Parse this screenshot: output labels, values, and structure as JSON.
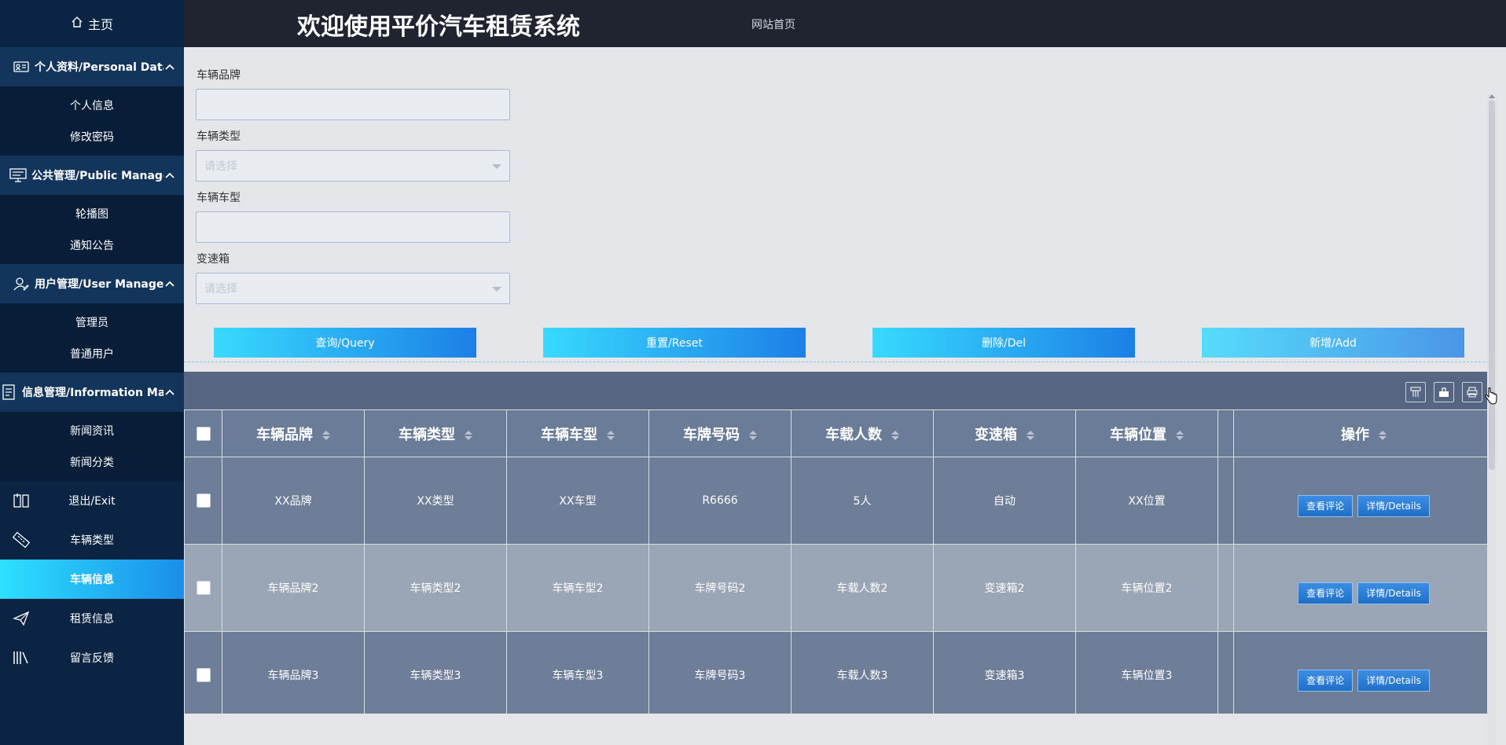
{
  "sidebar": {
    "home_label": "主页",
    "groups": [
      {
        "label": "个人资料/Personal Data",
        "items": [
          "个人信息",
          "修改密码"
        ]
      },
      {
        "label": "公共管理/Public Manage",
        "items": [
          "轮播图",
          "通知公告"
        ]
      },
      {
        "label": "用户管理/User Manage",
        "items": [
          "管理员",
          "普通用户"
        ]
      },
      {
        "label": "信息管理/Information Manage",
        "items": [
          "新闻资讯",
          "新闻分类"
        ]
      }
    ],
    "top_items": [
      "退出/Exit",
      "车辆类型",
      "车辆信息",
      "租赁信息",
      "留言反馈"
    ],
    "active_item": "车辆信息"
  },
  "header": {
    "title": "欢迎使用平价汽车租赁系统",
    "home_link": "网站首页"
  },
  "form": {
    "brand_label": "车辆品牌",
    "brand_value": "",
    "type_label": "车辆类型",
    "type_placeholder": "请选择",
    "model_label": "车辆车型",
    "model_value": "",
    "gearbox_label": "变速箱",
    "gearbox_placeholder": "请选择"
  },
  "actions": {
    "query": "查询/Query",
    "reset": "重置/Reset",
    "delete": "删除/Del",
    "add": "新增/Add"
  },
  "table": {
    "columns": [
      "车辆品牌",
      "车辆类型",
      "车辆车型",
      "车牌号码",
      "车载人数",
      "变速箱",
      "车辆位置",
      "操作"
    ],
    "rows": [
      [
        "XX品牌",
        "XX类型",
        "XX车型",
        "R6666",
        "5人",
        "自动",
        "XX位置"
      ],
      [
        "车辆品牌2",
        "车辆类型2",
        "车辆车型2",
        "车牌号码2",
        "车载人数2",
        "变速箱2",
        "车辆位置2"
      ],
      [
        "车辆品牌3",
        "车辆类型3",
        "车辆车型3",
        "车牌号码3",
        "车载人数3",
        "变速箱3",
        "车辆位置3"
      ]
    ],
    "row_buttons": {
      "comments": "查看评论",
      "details": "详情/Details"
    }
  },
  "colors": {
    "sidebar_bg": "#0b2443",
    "header_bg": "#1f2430",
    "accent_start": "#38dafe",
    "accent_end": "#1c7fe6",
    "table_bg": "#566682"
  }
}
